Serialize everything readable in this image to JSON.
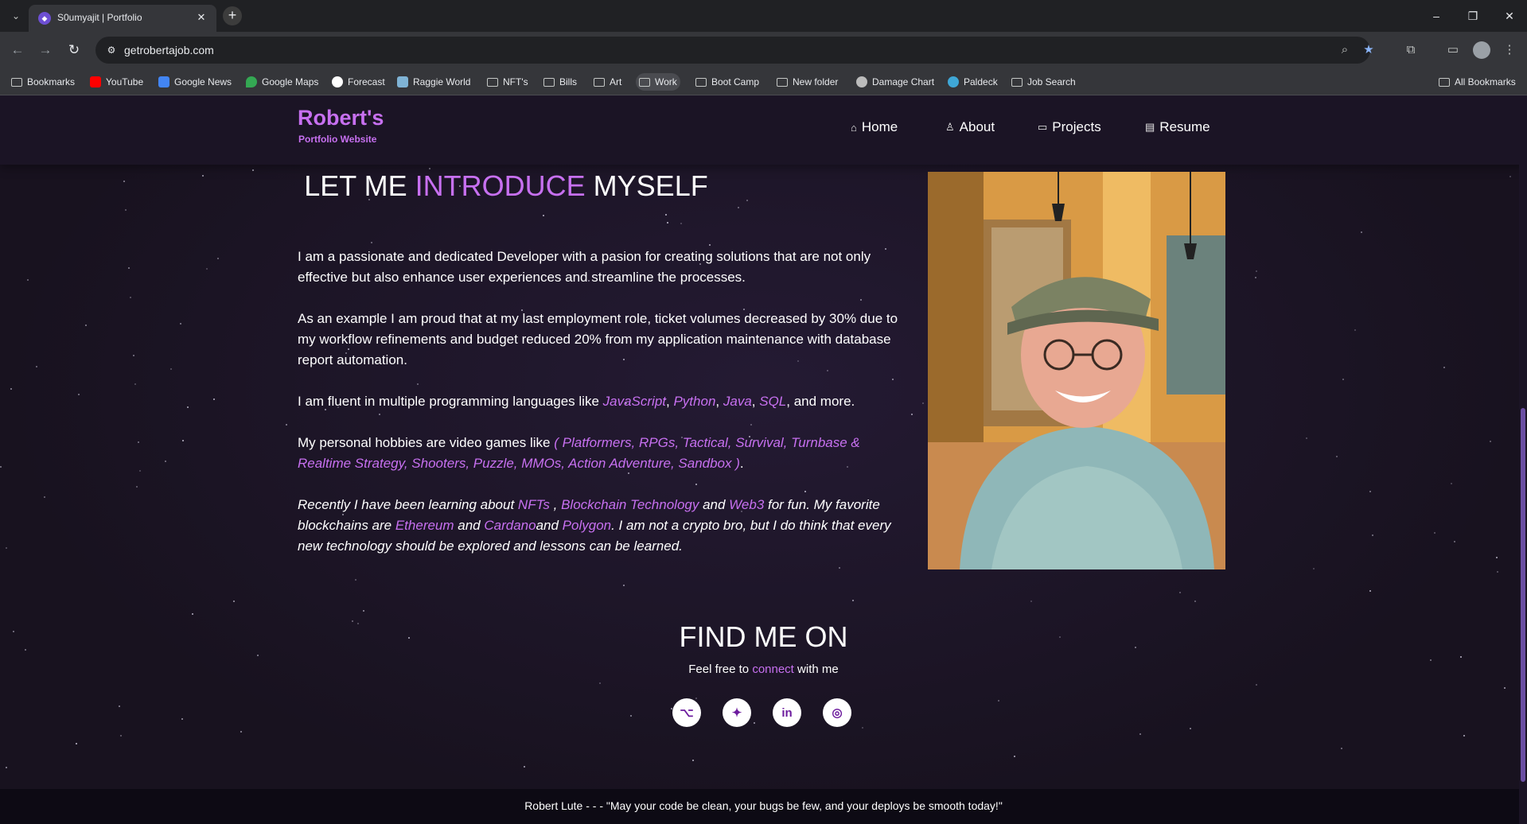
{
  "browser": {
    "tab": {
      "title": "S0umyajit | Portfolio",
      "favicon": "portfolio-favicon"
    },
    "new_tab_label": "+",
    "url": "getrobertajob.com",
    "bookmarks": [
      {
        "label": "Bookmarks",
        "icon": "folder-icon"
      },
      {
        "label": "YouTube",
        "icon": "youtube-icon"
      },
      {
        "label": "Google News",
        "icon": "google-news-icon"
      },
      {
        "label": "Google Maps",
        "icon": "google-maps-icon"
      },
      {
        "label": "Forecast",
        "icon": "weather-icon"
      },
      {
        "label": "Raggie World",
        "icon": "site-icon"
      },
      {
        "label": "NFT's",
        "icon": "folder-icon"
      },
      {
        "label": "Bills",
        "icon": "folder-icon"
      },
      {
        "label": "Art",
        "icon": "folder-icon"
      },
      {
        "label": "Work",
        "icon": "folder-icon"
      },
      {
        "label": "Boot Camp",
        "icon": "folder-icon"
      },
      {
        "label": "New folder",
        "icon": "folder-icon"
      },
      {
        "label": "Damage Chart",
        "icon": "site-icon"
      },
      {
        "label": "Paldeck",
        "icon": "site-icon"
      },
      {
        "label": "Job Search",
        "icon": "folder-icon"
      }
    ],
    "all_bookmarks": "All Bookmarks"
  },
  "site": {
    "brand": {
      "title": "Robert's",
      "subtitle": "Portfolio Website"
    },
    "nav": [
      {
        "label": "Home",
        "icon": "home-icon"
      },
      {
        "label": "About",
        "icon": "user-icon"
      },
      {
        "label": "Projects",
        "icon": "projects-icon"
      },
      {
        "label": "Resume",
        "icon": "document-icon"
      }
    ]
  },
  "intro": {
    "title_pre": "LET ME",
    "title_highlight": "INTRODUCE",
    "title_post": "MYSELF",
    "p1": "I am a passionate and dedicated Developer with a pasion for creating solutions that are not only effective but also enhance user experiences and streamline the processes.",
    "p2": "As an example I am proud that at my last employment role, ticket volumes decreased by 30% due to my workflow refinements and budget reduced 20% from my application maintenance with database report automation.",
    "p3_pre": "I am fluent in multiple programming languages like ",
    "languages": [
      "JavaScript",
      "Python",
      "Java",
      "SQL"
    ],
    "p3_post": ", and more.",
    "p4_pre": "My personal hobbies are video games like ",
    "games": "( Platformers, RPGs, Tactical, Survival, Turnbase & Realtime Strategy, Shooters, Puzzle, MMOs, Action Adventure, Sandbox )",
    "p4_post": ".",
    "p5_a": "Recently I have been learning about ",
    "p5_nfts": "NFTs",
    "p5_b": " , ",
    "p5_blockchain": "Blockchain Technology",
    "p5_c": " and ",
    "p5_web3": "Web3",
    "p5_d": " for fun. My favorite blockchains are ",
    "p5_eth": "Ethereum",
    "p5_e": " and ",
    "p5_cardano": "Cardano",
    "p5_f": "and ",
    "p5_polygon": "Polygon",
    "p5_g": ". I am not a crypto bro, but I do think that every new technology should be explored and lessons can be learned.",
    "photo": "profile-photo"
  },
  "find": {
    "title": "FIND ME ON",
    "sub_pre": "Feel free to ",
    "sub_link": "connect",
    "sub_post": " with me",
    "socials": [
      {
        "name": "github-icon",
        "glyph": "⌥"
      },
      {
        "name": "twitter-icon",
        "glyph": "✦"
      },
      {
        "name": "linkedin-icon",
        "glyph": "in"
      },
      {
        "name": "instagram-icon",
        "glyph": "◎"
      }
    ]
  },
  "footer": {
    "text": "Robert Lute - - - \"May your code be clean, your bugs be few, and your deploys be smooth today!\""
  },
  "colors": {
    "accent": "#c770f0",
    "background": "#1c1527",
    "chrome": "#35363a"
  }
}
